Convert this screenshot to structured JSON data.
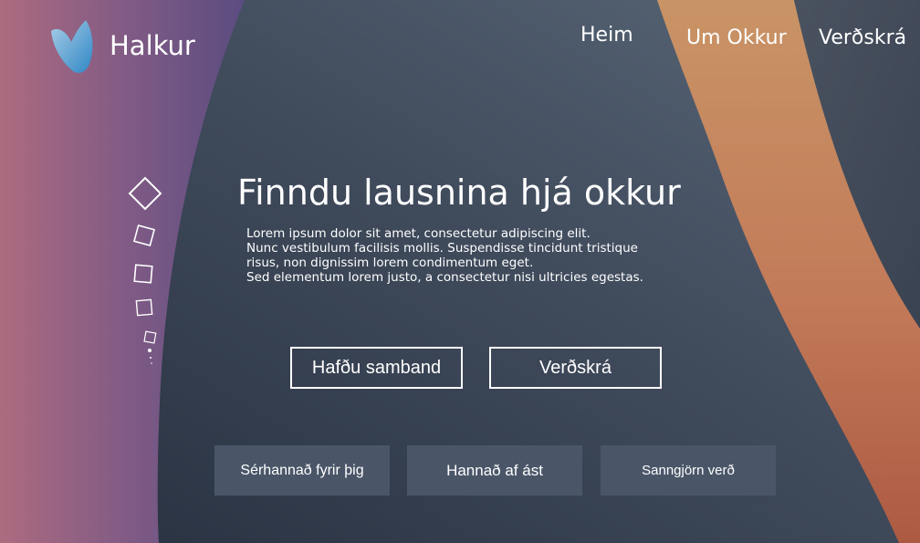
{
  "brand": {
    "name": "Halkur",
    "logo_icon": "heart-drop-logo-icon"
  },
  "nav": {
    "items": [
      {
        "label": "Heim"
      },
      {
        "label": "Um Okkur"
      },
      {
        "label": "Verðskrá"
      }
    ]
  },
  "hero": {
    "title": "Finndu lausnina hjá okkur",
    "lines": [
      "Lorem ipsum dolor sit amet, consectetur adipiscing elit.",
      "Nunc vestibulum facilisis mollis. Suspendisse tincidunt tristique",
      "risus, non dignissim lorem condimentum eget.",
      "Sed elementum lorem justo, a consectetur nisi ultricies egestas."
    ],
    "buttons": {
      "contact": "Hafðu samband",
      "pricing": "Verðskrá"
    }
  },
  "features": [
    {
      "label": "Sérhannað fyrir þig"
    },
    {
      "label": "Hannað af ást"
    },
    {
      "label": "Sanngjörn verð"
    }
  ],
  "colors": {
    "background": "#3a4454",
    "left_band_pink": "#a8687e",
    "left_band_purple": "#5e4d84",
    "right_band_orange": "#c88a5c",
    "right_band_red": "#b05a44",
    "card": "#4a5668",
    "text": "#ffffff"
  },
  "slide_indicator": {
    "shape_icon": "diamond-outline-icon",
    "active_index": 0
  }
}
